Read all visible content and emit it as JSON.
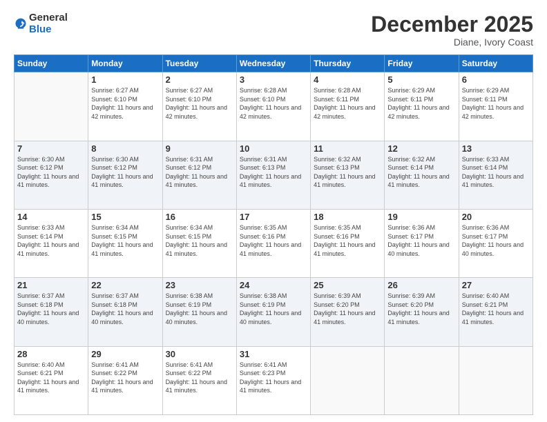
{
  "header": {
    "logo_general": "General",
    "logo_blue": "Blue",
    "month_title": "December 2025",
    "location": "Diane, Ivory Coast"
  },
  "days_of_week": [
    "Sunday",
    "Monday",
    "Tuesday",
    "Wednesday",
    "Thursday",
    "Friday",
    "Saturday"
  ],
  "weeks": [
    {
      "days": [
        {
          "num": "",
          "sunrise": "",
          "sunset": "",
          "daylight": "",
          "empty": true
        },
        {
          "num": "1",
          "sunrise": "Sunrise: 6:27 AM",
          "sunset": "Sunset: 6:10 PM",
          "daylight": "Daylight: 11 hours and 42 minutes.",
          "empty": false
        },
        {
          "num": "2",
          "sunrise": "Sunrise: 6:27 AM",
          "sunset": "Sunset: 6:10 PM",
          "daylight": "Daylight: 11 hours and 42 minutes.",
          "empty": false
        },
        {
          "num": "3",
          "sunrise": "Sunrise: 6:28 AM",
          "sunset": "Sunset: 6:10 PM",
          "daylight": "Daylight: 11 hours and 42 minutes.",
          "empty": false
        },
        {
          "num": "4",
          "sunrise": "Sunrise: 6:28 AM",
          "sunset": "Sunset: 6:11 PM",
          "daylight": "Daylight: 11 hours and 42 minutes.",
          "empty": false
        },
        {
          "num": "5",
          "sunrise": "Sunrise: 6:29 AM",
          "sunset": "Sunset: 6:11 PM",
          "daylight": "Daylight: 11 hours and 42 minutes.",
          "empty": false
        },
        {
          "num": "6",
          "sunrise": "Sunrise: 6:29 AM",
          "sunset": "Sunset: 6:11 PM",
          "daylight": "Daylight: 11 hours and 42 minutes.",
          "empty": false
        }
      ]
    },
    {
      "days": [
        {
          "num": "7",
          "sunrise": "Sunrise: 6:30 AM",
          "sunset": "Sunset: 6:12 PM",
          "daylight": "Daylight: 11 hours and 41 minutes.",
          "empty": false
        },
        {
          "num": "8",
          "sunrise": "Sunrise: 6:30 AM",
          "sunset": "Sunset: 6:12 PM",
          "daylight": "Daylight: 11 hours and 41 minutes.",
          "empty": false
        },
        {
          "num": "9",
          "sunrise": "Sunrise: 6:31 AM",
          "sunset": "Sunset: 6:12 PM",
          "daylight": "Daylight: 11 hours and 41 minutes.",
          "empty": false
        },
        {
          "num": "10",
          "sunrise": "Sunrise: 6:31 AM",
          "sunset": "Sunset: 6:13 PM",
          "daylight": "Daylight: 11 hours and 41 minutes.",
          "empty": false
        },
        {
          "num": "11",
          "sunrise": "Sunrise: 6:32 AM",
          "sunset": "Sunset: 6:13 PM",
          "daylight": "Daylight: 11 hours and 41 minutes.",
          "empty": false
        },
        {
          "num": "12",
          "sunrise": "Sunrise: 6:32 AM",
          "sunset": "Sunset: 6:14 PM",
          "daylight": "Daylight: 11 hours and 41 minutes.",
          "empty": false
        },
        {
          "num": "13",
          "sunrise": "Sunrise: 6:33 AM",
          "sunset": "Sunset: 6:14 PM",
          "daylight": "Daylight: 11 hours and 41 minutes.",
          "empty": false
        }
      ]
    },
    {
      "days": [
        {
          "num": "14",
          "sunrise": "Sunrise: 6:33 AM",
          "sunset": "Sunset: 6:14 PM",
          "daylight": "Daylight: 11 hours and 41 minutes.",
          "empty": false
        },
        {
          "num": "15",
          "sunrise": "Sunrise: 6:34 AM",
          "sunset": "Sunset: 6:15 PM",
          "daylight": "Daylight: 11 hours and 41 minutes.",
          "empty": false
        },
        {
          "num": "16",
          "sunrise": "Sunrise: 6:34 AM",
          "sunset": "Sunset: 6:15 PM",
          "daylight": "Daylight: 11 hours and 41 minutes.",
          "empty": false
        },
        {
          "num": "17",
          "sunrise": "Sunrise: 6:35 AM",
          "sunset": "Sunset: 6:16 PM",
          "daylight": "Daylight: 11 hours and 41 minutes.",
          "empty": false
        },
        {
          "num": "18",
          "sunrise": "Sunrise: 6:35 AM",
          "sunset": "Sunset: 6:16 PM",
          "daylight": "Daylight: 11 hours and 41 minutes.",
          "empty": false
        },
        {
          "num": "19",
          "sunrise": "Sunrise: 6:36 AM",
          "sunset": "Sunset: 6:17 PM",
          "daylight": "Daylight: 11 hours and 40 minutes.",
          "empty": false
        },
        {
          "num": "20",
          "sunrise": "Sunrise: 6:36 AM",
          "sunset": "Sunset: 6:17 PM",
          "daylight": "Daylight: 11 hours and 40 minutes.",
          "empty": false
        }
      ]
    },
    {
      "days": [
        {
          "num": "21",
          "sunrise": "Sunrise: 6:37 AM",
          "sunset": "Sunset: 6:18 PM",
          "daylight": "Daylight: 11 hours and 40 minutes.",
          "empty": false
        },
        {
          "num": "22",
          "sunrise": "Sunrise: 6:37 AM",
          "sunset": "Sunset: 6:18 PM",
          "daylight": "Daylight: 11 hours and 40 minutes.",
          "empty": false
        },
        {
          "num": "23",
          "sunrise": "Sunrise: 6:38 AM",
          "sunset": "Sunset: 6:19 PM",
          "daylight": "Daylight: 11 hours and 40 minutes.",
          "empty": false
        },
        {
          "num": "24",
          "sunrise": "Sunrise: 6:38 AM",
          "sunset": "Sunset: 6:19 PM",
          "daylight": "Daylight: 11 hours and 40 minutes.",
          "empty": false
        },
        {
          "num": "25",
          "sunrise": "Sunrise: 6:39 AM",
          "sunset": "Sunset: 6:20 PM",
          "daylight": "Daylight: 11 hours and 41 minutes.",
          "empty": false
        },
        {
          "num": "26",
          "sunrise": "Sunrise: 6:39 AM",
          "sunset": "Sunset: 6:20 PM",
          "daylight": "Daylight: 11 hours and 41 minutes.",
          "empty": false
        },
        {
          "num": "27",
          "sunrise": "Sunrise: 6:40 AM",
          "sunset": "Sunset: 6:21 PM",
          "daylight": "Daylight: 11 hours and 41 minutes.",
          "empty": false
        }
      ]
    },
    {
      "days": [
        {
          "num": "28",
          "sunrise": "Sunrise: 6:40 AM",
          "sunset": "Sunset: 6:21 PM",
          "daylight": "Daylight: 11 hours and 41 minutes.",
          "empty": false
        },
        {
          "num": "29",
          "sunrise": "Sunrise: 6:41 AM",
          "sunset": "Sunset: 6:22 PM",
          "daylight": "Daylight: 11 hours and 41 minutes.",
          "empty": false
        },
        {
          "num": "30",
          "sunrise": "Sunrise: 6:41 AM",
          "sunset": "Sunset: 6:22 PM",
          "daylight": "Daylight: 11 hours and 41 minutes.",
          "empty": false
        },
        {
          "num": "31",
          "sunrise": "Sunrise: 6:41 AM",
          "sunset": "Sunset: 6:23 PM",
          "daylight": "Daylight: 11 hours and 41 minutes.",
          "empty": false
        },
        {
          "num": "",
          "sunrise": "",
          "sunset": "",
          "daylight": "",
          "empty": true
        },
        {
          "num": "",
          "sunrise": "",
          "sunset": "",
          "daylight": "",
          "empty": true
        },
        {
          "num": "",
          "sunrise": "",
          "sunset": "",
          "daylight": "",
          "empty": true
        }
      ]
    }
  ]
}
